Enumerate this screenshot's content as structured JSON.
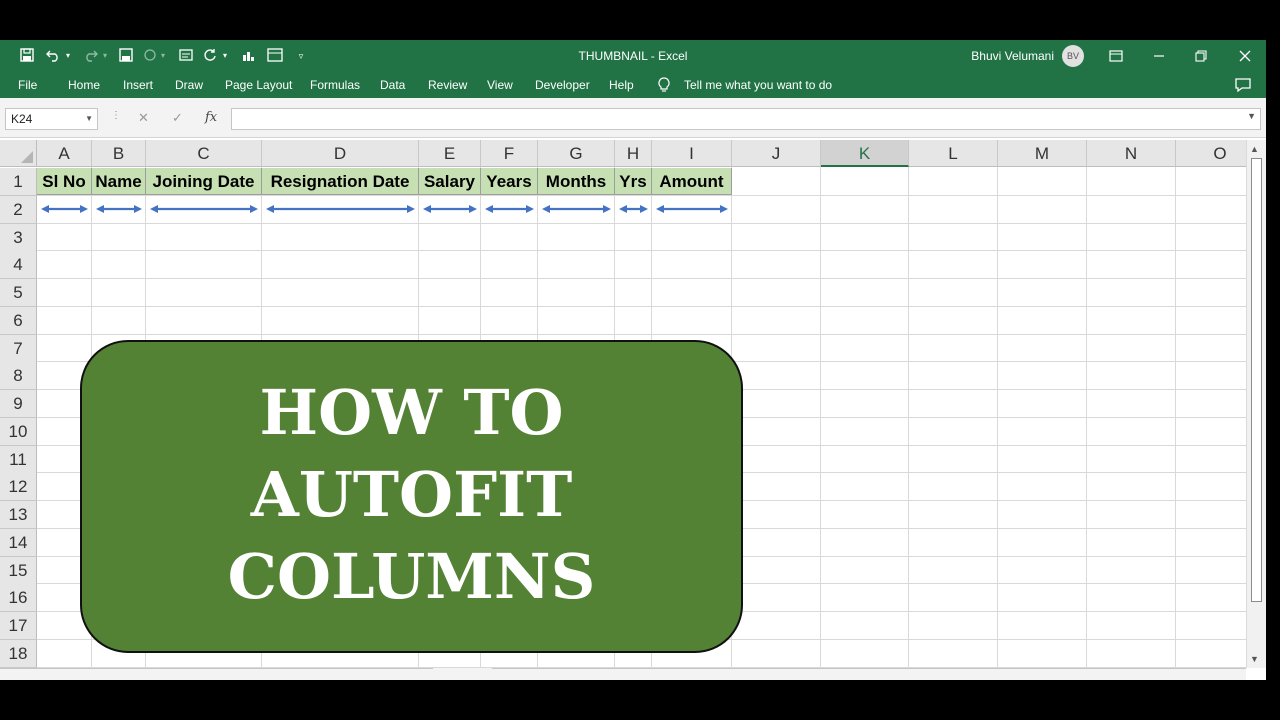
{
  "window": {
    "title": "THUMBNAIL  -  Excel",
    "user_name": "Bhuvi Velumani",
    "user_initials": "BV"
  },
  "ribbon_tabs": [
    "File",
    "Home",
    "Insert",
    "Draw",
    "Page Layout",
    "Formulas",
    "Data",
    "Review",
    "View",
    "Developer",
    "Help"
  ],
  "tell_me": "Tell me what you want to do",
  "formula_bar": {
    "name_box": "K24",
    "fx_label": "fx",
    "formula": ""
  },
  "columns": [
    "A",
    "B",
    "C",
    "D",
    "E",
    "F",
    "G",
    "H",
    "I",
    "J",
    "K",
    "L",
    "M",
    "N",
    "O"
  ],
  "selected_column": "K",
  "rows": [
    "1",
    "2",
    "3",
    "4",
    "5",
    "6",
    "7",
    "8",
    "9",
    "10",
    "11",
    "12",
    "13",
    "14",
    "15",
    "16",
    "17",
    "18"
  ],
  "header_cells": [
    "Sl No",
    "Name",
    "Joining Date",
    "Resignation Date",
    "Salary",
    "Years",
    "Months",
    "Yrs",
    "Amount"
  ],
  "banner": {
    "lines": [
      "HOW TO",
      "AUTOFIT",
      "COLUMNS"
    ]
  },
  "colors": {
    "accent": "#217346",
    "header_fill": "#c6e0b4",
    "banner_fill": "#548235",
    "arrow": "#4472c4"
  },
  "icons": {
    "save": "save-icon",
    "undo": "undo-icon",
    "redo": "redo-icon",
    "lightbulb": "lightbulb-icon",
    "comments": "comment-icon"
  }
}
